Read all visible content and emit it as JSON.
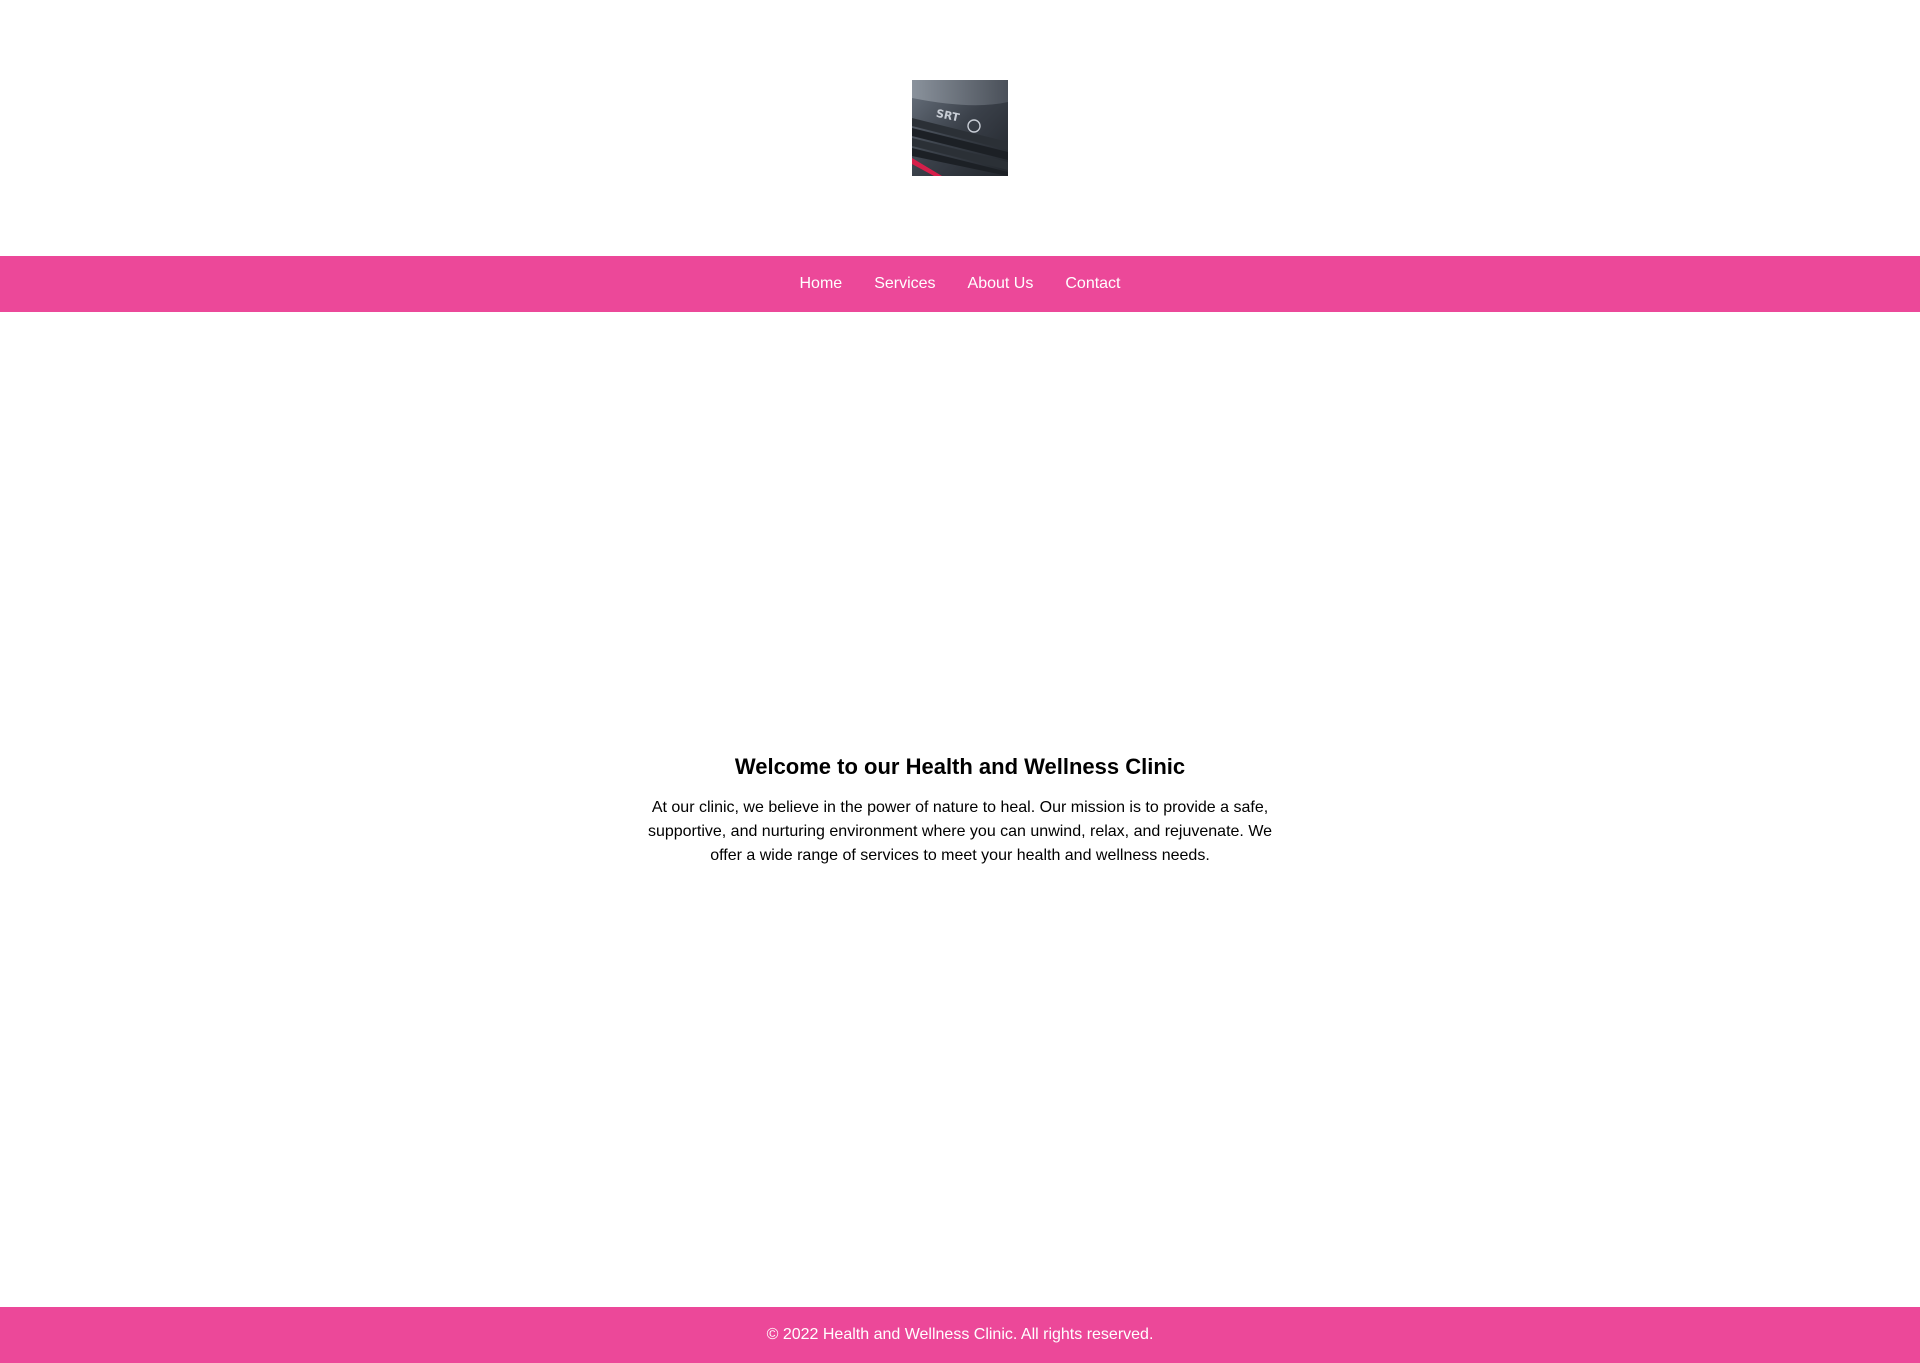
{
  "header": {
    "logo_icon": "car-grille-photo-icon"
  },
  "nav": {
    "items": [
      {
        "label": "Home"
      },
      {
        "label": "Services"
      },
      {
        "label": "About Us"
      },
      {
        "label": "Contact"
      }
    ]
  },
  "main": {
    "title": "Welcome to our Health and Wellness Clinic",
    "body": "At our clinic, we believe in the power of nature to heal. Our mission is to provide a safe, supportive, and nurturing environment where you can unwind, relax, and rejuvenate. We offer a wide range of services to meet your health and wellness needs."
  },
  "footer": {
    "text": "© 2022 Health and Wellness Clinic. All rights reserved."
  },
  "colors": {
    "accent": "#ec4899",
    "background": "#ffffff",
    "text": "#000000",
    "nav_text": "#ffffff"
  }
}
